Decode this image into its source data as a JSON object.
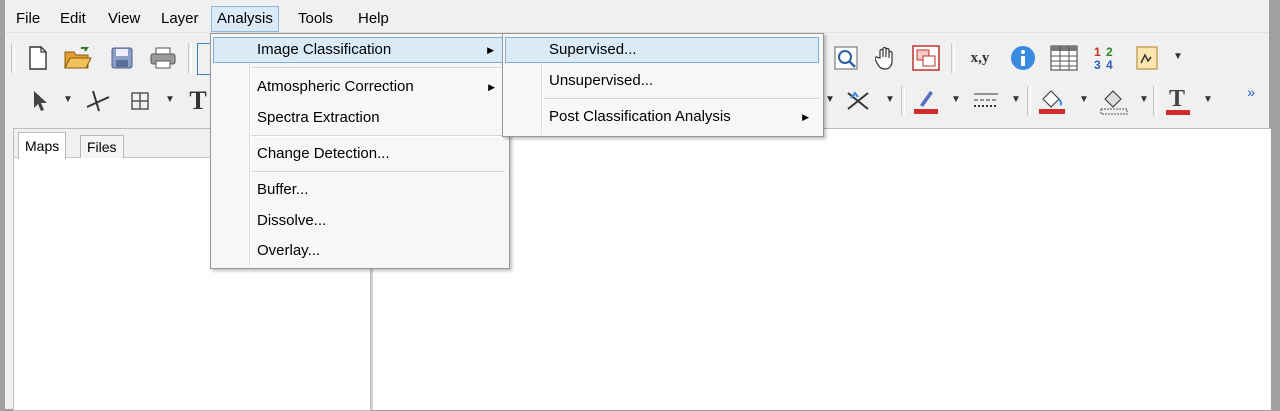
{
  "menubar": {
    "items": [
      "File",
      "Edit",
      "View",
      "Layer",
      "Analysis",
      "Tools",
      "Help"
    ],
    "active": "Analysis"
  },
  "toolbar1": {
    "icons": [
      "new-file-icon",
      "open-folder-icon",
      "save-icon",
      "print-icon",
      "zoom-window-icon",
      "pan-hand-icon",
      "zoom-extent-icon",
      "xy-coordinates-icon",
      "info-icon",
      "attribute-table-icon",
      "numbering-icon",
      "measure-icon"
    ],
    "xy_label": "x,y"
  },
  "toolbar2": {
    "icons": [
      "select-arrow-icon",
      "edit-vertex-icon",
      "grid-icon",
      "text-tool-icon",
      "delete-feature-icon",
      "line-color-icon",
      "line-style-icon",
      "fill-color-icon",
      "outline-color-icon",
      "font-color-icon"
    ],
    "text_glyph": "T",
    "overflow": "»"
  },
  "left_panel": {
    "tabs": [
      "Maps",
      "Files"
    ],
    "selected_tab": "Maps"
  },
  "analysis_menu": {
    "items": [
      {
        "label": "Image Classification",
        "submenu": true,
        "highlighted": true
      },
      {
        "label": "Atmospheric Correction",
        "submenu": true
      },
      {
        "label": "Spectra Extraction",
        "submenu": false
      },
      {
        "label": "Change Detection...",
        "submenu": false
      },
      {
        "label": "Buffer...",
        "submenu": false
      },
      {
        "label": "Dissolve...",
        "submenu": false
      },
      {
        "label": "Overlay...",
        "submenu": false
      }
    ]
  },
  "classification_submenu": {
    "items": [
      {
        "label": "Supervised...",
        "highlighted": true
      },
      {
        "label": "Unsupervised..."
      },
      {
        "label": "Post Classification Analysis",
        "submenu": true
      }
    ]
  },
  "colors": {
    "menu_highlight": "#dbeaf7",
    "menu_highlight_border": "#7db0e0",
    "background": "#f0f0f0"
  }
}
